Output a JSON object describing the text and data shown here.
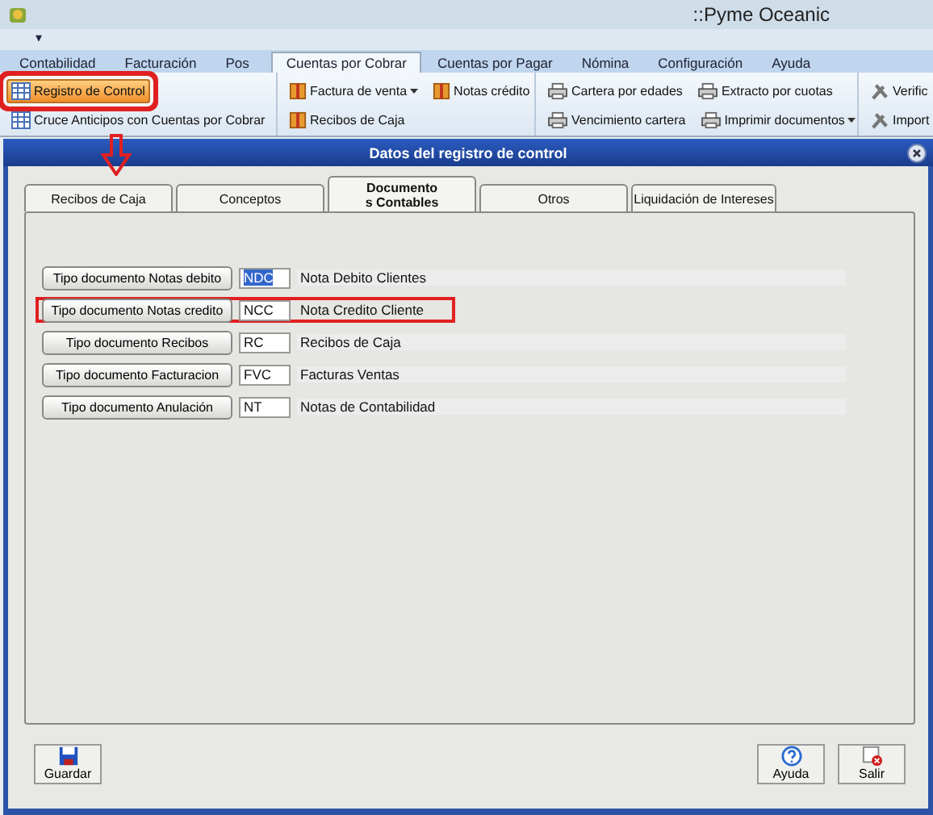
{
  "window": {
    "title": "::Pyme Oceanic",
    "quick_access": "▾"
  },
  "ribbon": {
    "tabs": [
      {
        "label": "Contabilidad",
        "selected": false
      },
      {
        "label": "Facturación",
        "selected": false
      },
      {
        "label": "Pos",
        "selected": false
      },
      {
        "label": "Cuentas por Cobrar",
        "selected": true
      },
      {
        "label": "Cuentas por Pagar",
        "selected": false
      },
      {
        "label": "Nómina",
        "selected": false
      },
      {
        "label": "Configuración",
        "selected": false
      },
      {
        "label": "Ayuda",
        "selected": false
      }
    ],
    "groups": [
      [
        [
          {
            "label": "Registro de Control",
            "kind": "table",
            "highlighted": true,
            "annotated": true,
            "dropdown": false
          }
        ],
        [
          {
            "label": "Cruce Anticipos con Cuentas por Cobrar",
            "kind": "table",
            "highlighted": false,
            "annotated": false,
            "dropdown": false
          }
        ]
      ],
      [
        [
          {
            "label": "Factura de venta",
            "kind": "book",
            "highlighted": false,
            "annotated": false,
            "dropdown": true
          },
          {
            "label": "Notas crédito",
            "kind": "book",
            "highlighted": false,
            "annotated": false,
            "dropdown": false
          }
        ],
        [
          {
            "label": "Recibos de Caja",
            "kind": "book",
            "highlighted": false,
            "annotated": false,
            "dropdown": false
          }
        ]
      ],
      [
        [
          {
            "label": "Cartera por edades",
            "kind": "printer",
            "highlighted": false,
            "annotated": false,
            "dropdown": false
          },
          {
            "label": "Extracto por cuotas",
            "kind": "printer",
            "highlighted": false,
            "annotated": false,
            "dropdown": false
          }
        ],
        [
          {
            "label": "Vencimiento cartera",
            "kind": "printer",
            "highlighted": false,
            "annotated": false,
            "dropdown": false
          },
          {
            "label": "Imprimir documentos",
            "kind": "printer",
            "highlighted": false,
            "annotated": false,
            "dropdown": true
          }
        ]
      ],
      [
        [
          {
            "label": "Verific",
            "kind": "tools",
            "highlighted": false,
            "annotated": false
          }
        ],
        [
          {
            "label": "Import",
            "kind": "tools",
            "highlighted": false,
            "annotated": false
          }
        ]
      ]
    ]
  },
  "dialog": {
    "title": "Datos del registro de control",
    "tabs": [
      {
        "label": "Recibos de Caja",
        "selected": false
      },
      {
        "label": "Conceptos",
        "selected": false
      },
      {
        "label": "Documento\ns Contables",
        "selected": true
      },
      {
        "label": "Otros",
        "selected": false
      },
      {
        "label": "Liquidación de Intereses",
        "selected": false
      }
    ],
    "rows": [
      {
        "button": "Tipo documento Notas debito",
        "code": "NDC",
        "text_selected": true,
        "description": "Nota Debito Clientes",
        "annotated": false
      },
      {
        "button": "Tipo documento Notas credito",
        "code": "NCC",
        "text_selected": false,
        "description": "Nota Credito Cliente",
        "annotated": true
      },
      {
        "button": "Tipo documento Recibos",
        "code": "RC",
        "text_selected": false,
        "description": "Recibos de Caja",
        "annotated": false
      },
      {
        "button": "Tipo documento Facturacion",
        "code": "FVC",
        "text_selected": false,
        "description": "Facturas Ventas",
        "annotated": false
      },
      {
        "button": "Tipo documento Anulación",
        "code": "NT",
        "text_selected": false,
        "description": "Notas de Contabilidad",
        "annotated": false
      }
    ],
    "buttons": [
      {
        "label": "Guardar",
        "kind": "save"
      },
      {
        "label": "Ayuda",
        "kind": "help"
      },
      {
        "label": "Salir",
        "kind": "exit"
      }
    ]
  }
}
